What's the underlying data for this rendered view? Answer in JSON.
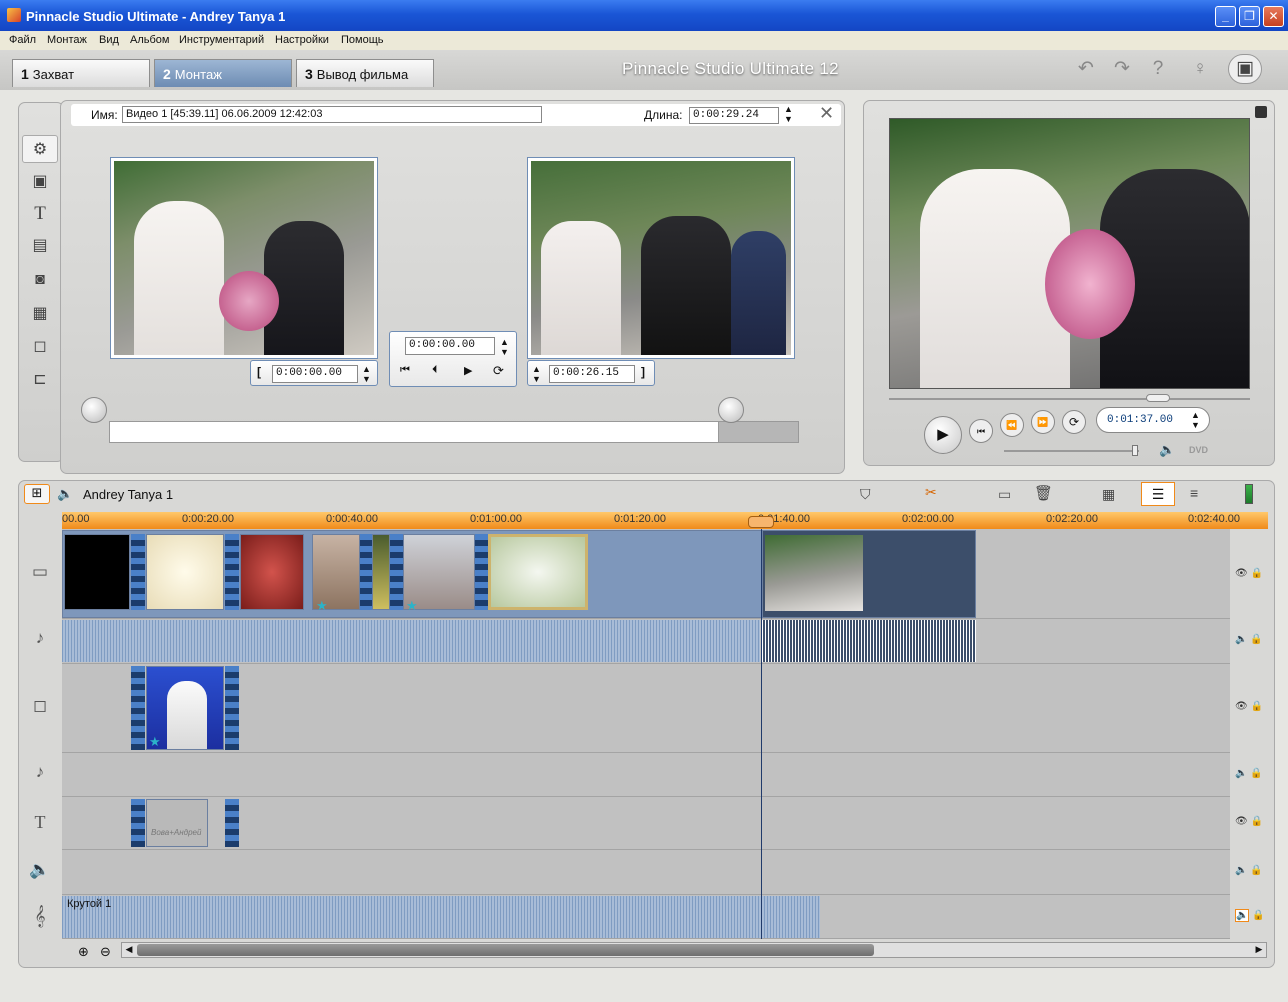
{
  "window": {
    "title": "Pinnacle Studio Ultimate - Andrey Tanya 1"
  },
  "menu": [
    "Файл",
    "Монтаж",
    "Вид",
    "Альбом",
    "Инструментарий",
    "Настройки",
    "Помощь"
  ],
  "tabs": [
    {
      "num": "1",
      "label": "Захват"
    },
    {
      "num": "2",
      "label": "Монтаж"
    },
    {
      "num": "3",
      "label": "Вывод фильма"
    }
  ],
  "brand": "Pinnacle Studio Ultimate 12",
  "editor": {
    "name_label": "Имя:",
    "name_value": "Видео 1 [45:39.11]  06.06.2009 12:42:03",
    "length_label": "Длина:",
    "length_value": "0:00:29.24",
    "in_time": "0:00:00.00",
    "center_time": "0:00:00.00",
    "out_time": "0:00:26.15",
    "bracket_open": "[",
    "bracket_close": "]"
  },
  "preview": {
    "timecode": "0:01:37.00",
    "dvd_label": "DVD"
  },
  "timeline": {
    "project_name": "Andrey Tanya 1",
    "ruler": [
      "00.00",
      "0:00:20.00",
      "0:00:40.00",
      "0:01:00.00",
      "0:01:20.00",
      "0:01:40.00",
      "0:02:00.00",
      "0:02:20.00",
      "0:02:40.00"
    ],
    "music_clip": "Крутой 1",
    "title_clip": "Вова+Андрей"
  },
  "colors": {
    "accent": "#f08a1a",
    "selected_clip": "#3c4e6a",
    "track": "#c1c1c1"
  }
}
